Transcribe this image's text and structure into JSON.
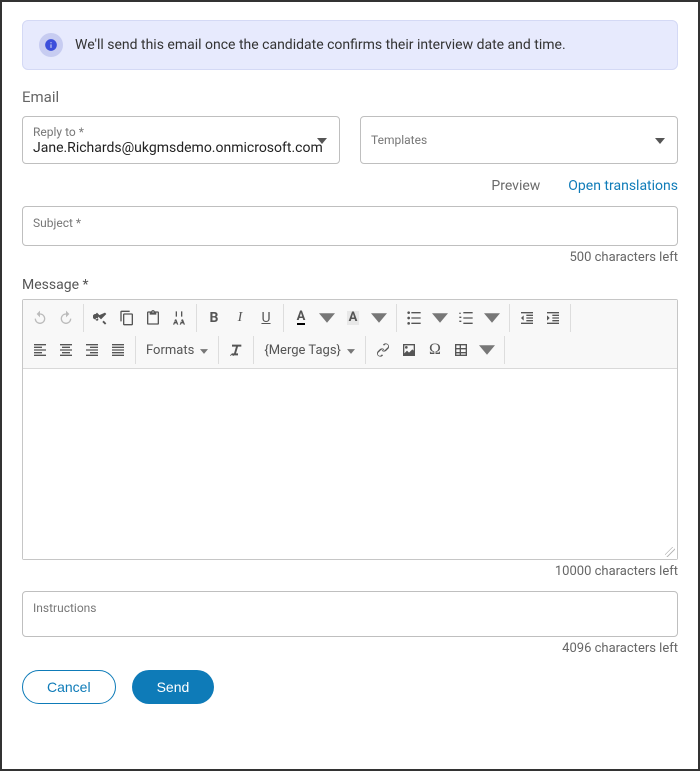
{
  "banner": {
    "text": "We'll send this email once the candidate confirms their interview date and time."
  },
  "section_title": "Email",
  "reply_to": {
    "label": "Reply to *",
    "value": "Jane.Richards@ukgmsdemo.onmicrosoft.com"
  },
  "templates": {
    "label": "Templates"
  },
  "links": {
    "preview": "Preview",
    "open_translations": "Open translations"
  },
  "subject": {
    "label": "Subject *",
    "helper": "500 characters left"
  },
  "message": {
    "label": "Message *",
    "helper": "10000 characters left"
  },
  "toolbar": {
    "formats": "Formats",
    "merge_tags": "{Merge Tags}"
  },
  "instructions": {
    "label": "Instructions",
    "helper": "4096 characters left"
  },
  "buttons": {
    "cancel": "Cancel",
    "send": "Send"
  }
}
